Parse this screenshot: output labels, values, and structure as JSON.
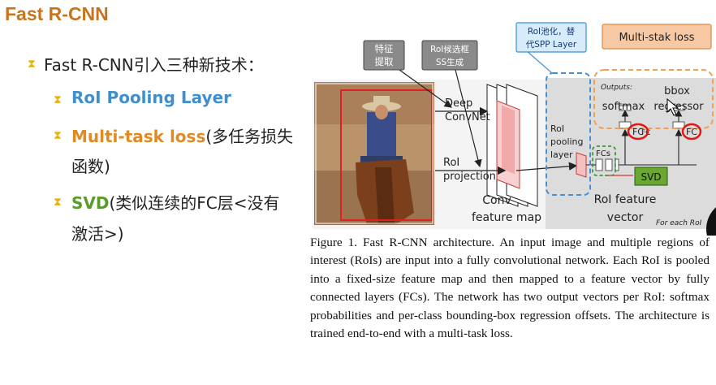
{
  "slide": {
    "title": "Fast R-CNN",
    "intro": "Fast R-CNN引入三种新技术：",
    "items": [
      {
        "keyword": "RoI Pooling Layer",
        "rest": "",
        "cont": ""
      },
      {
        "keyword": "Multi-task loss",
        "rest": "(多任务损失",
        "cont": "函数)"
      },
      {
        "keyword": "SVD",
        "rest": "(类似连续的FC层<没有",
        "cont": "激活>)"
      }
    ]
  },
  "annotations": {
    "feature_extract": [
      "特征",
      "提取"
    ],
    "roi_ss": [
      "RoI候选框",
      "SS生成"
    ],
    "roi_pool_note": [
      "RoI池化，替",
      "代SPP Layer"
    ],
    "multi_loss": "Multi-stak loss",
    "svd": "SVD",
    "fc": "FC"
  },
  "figure": {
    "deep_convnet": [
      "Deep",
      "ConvNet"
    ],
    "roi_projection": [
      "RoI",
      "projection"
    ],
    "conv_feature_map": [
      "Conv",
      "feature map"
    ],
    "roi_pooling_layer": [
      "RoI",
      "pooling",
      "layer"
    ],
    "fcs": "FCs",
    "roi_feature_vector": [
      "RoI feature",
      "vector"
    ],
    "outputs": "Outputs:",
    "softmax": "softmax",
    "bbox_regressor": [
      "bbox",
      "regressor"
    ],
    "fc_small": "FC",
    "for_each_roi": "For each RoI",
    "caption": "Figure 1. Fast R-CNN architecture. An input image and multiple regions of interest (RoIs) are input into a fully convolutional network. Each RoI is pooled into a fixed-size feature map and then mapped to a feature vector by fully connected layers (FCs). The network has two output vectors per RoI: softmax probabilities and per-class bounding-box regression offsets. The architecture is trained end-to-end with a multi-task loss."
  }
}
